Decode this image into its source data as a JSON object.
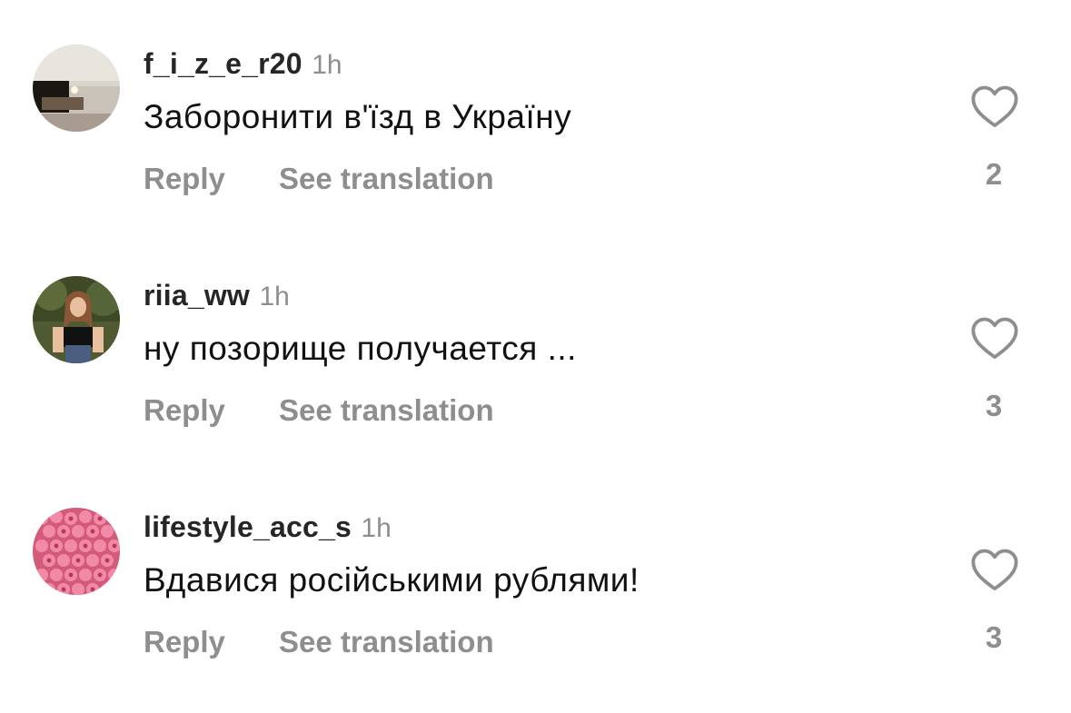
{
  "comments": [
    {
      "username": "f_i_z_e_r20",
      "time": "1h",
      "text": "Заборонити в'їзд в Україну",
      "reply_label": "Reply",
      "translate_label": "See translation",
      "like_icon": "heart-outline-icon",
      "likes": "2"
    },
    {
      "username": "riia_ww",
      "time": "1h",
      "text": "ну позорище получается ...",
      "reply_label": "Reply",
      "translate_label": "See translation",
      "like_icon": "heart-outline-icon",
      "likes": "3"
    },
    {
      "username": "lifestyle_acc_s",
      "time": "1h",
      "text": "Вдавися російськими рублями!",
      "reply_label": "Reply",
      "translate_label": "See translation",
      "like_icon": "heart-outline-icon",
      "likes": "3"
    }
  ],
  "colors": {
    "username": "#262626",
    "secondary": "#8e8e8e",
    "text": "#111111",
    "background": "#ffffff"
  }
}
